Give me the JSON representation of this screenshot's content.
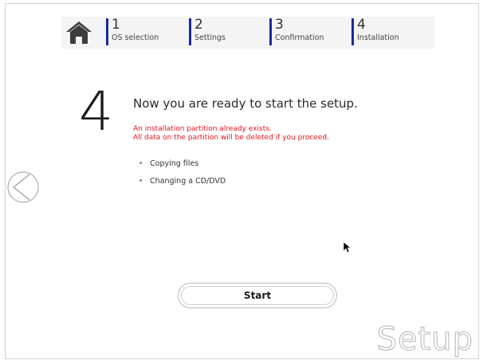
{
  "steps": [
    {
      "num": "1",
      "label": "OS selection"
    },
    {
      "num": "2",
      "label": "Settings"
    },
    {
      "num": "3",
      "label": "Confirmation"
    },
    {
      "num": "4",
      "label": "Installation"
    }
  ],
  "main": {
    "step_number": "4",
    "headline": "Now you are ready to start the setup.",
    "warning_line1": "An installation partition already exists.",
    "warning_line2": "All data on the partition will be deleted if you proceed.",
    "bullets": [
      "Copying files",
      "Changing a CD/DVD"
    ]
  },
  "actions": {
    "start_label": "Start"
  },
  "brand": {
    "watermark": "Setup"
  },
  "icons": {
    "home": "home-icon",
    "back": "back-arrow-icon",
    "cursor": "mouse-pointer-icon"
  },
  "colors": {
    "step_marker": "#1a2a9a",
    "warning": "#e0161b"
  }
}
